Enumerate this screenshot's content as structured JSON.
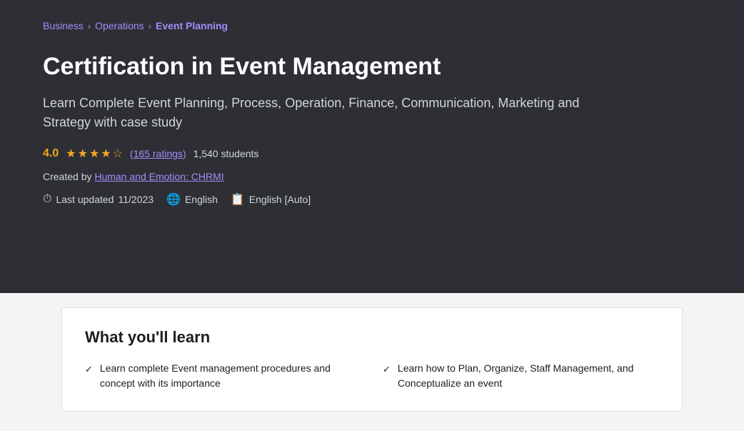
{
  "breadcrumb": {
    "items": [
      {
        "label": "Business",
        "active": false
      },
      {
        "label": "Operations",
        "active": false
      },
      {
        "label": "Event Planning",
        "active": true
      }
    ],
    "separator": "›"
  },
  "course": {
    "title": "Certification in Event Management",
    "subtitle": "Learn Complete Event Planning, Process, Operation, Finance, Communication, Marketing and Strategy with case study",
    "rating": {
      "score": "4.0",
      "ratings_count": "(165 ratings)",
      "students": "1,540 students"
    },
    "creator_label": "Created by",
    "creator_name": "Human and Emotion: CHRMI",
    "meta": {
      "last_updated_label": "Last updated",
      "last_updated_value": "11/2023",
      "language": "English",
      "captions": "English [Auto]"
    }
  },
  "what_you_learn": {
    "title": "What you'll learn",
    "items_left": [
      {
        "text": "Learn complete Event management procedures and concept with its importance"
      }
    ],
    "items_right": [
      {
        "text": "Learn how to Plan, Organize, Staff Management, and Conceptualize an event"
      }
    ]
  },
  "icons": {
    "globe": "🌐",
    "clock": "⏱",
    "captions": "📋",
    "checkmark": "✓"
  }
}
